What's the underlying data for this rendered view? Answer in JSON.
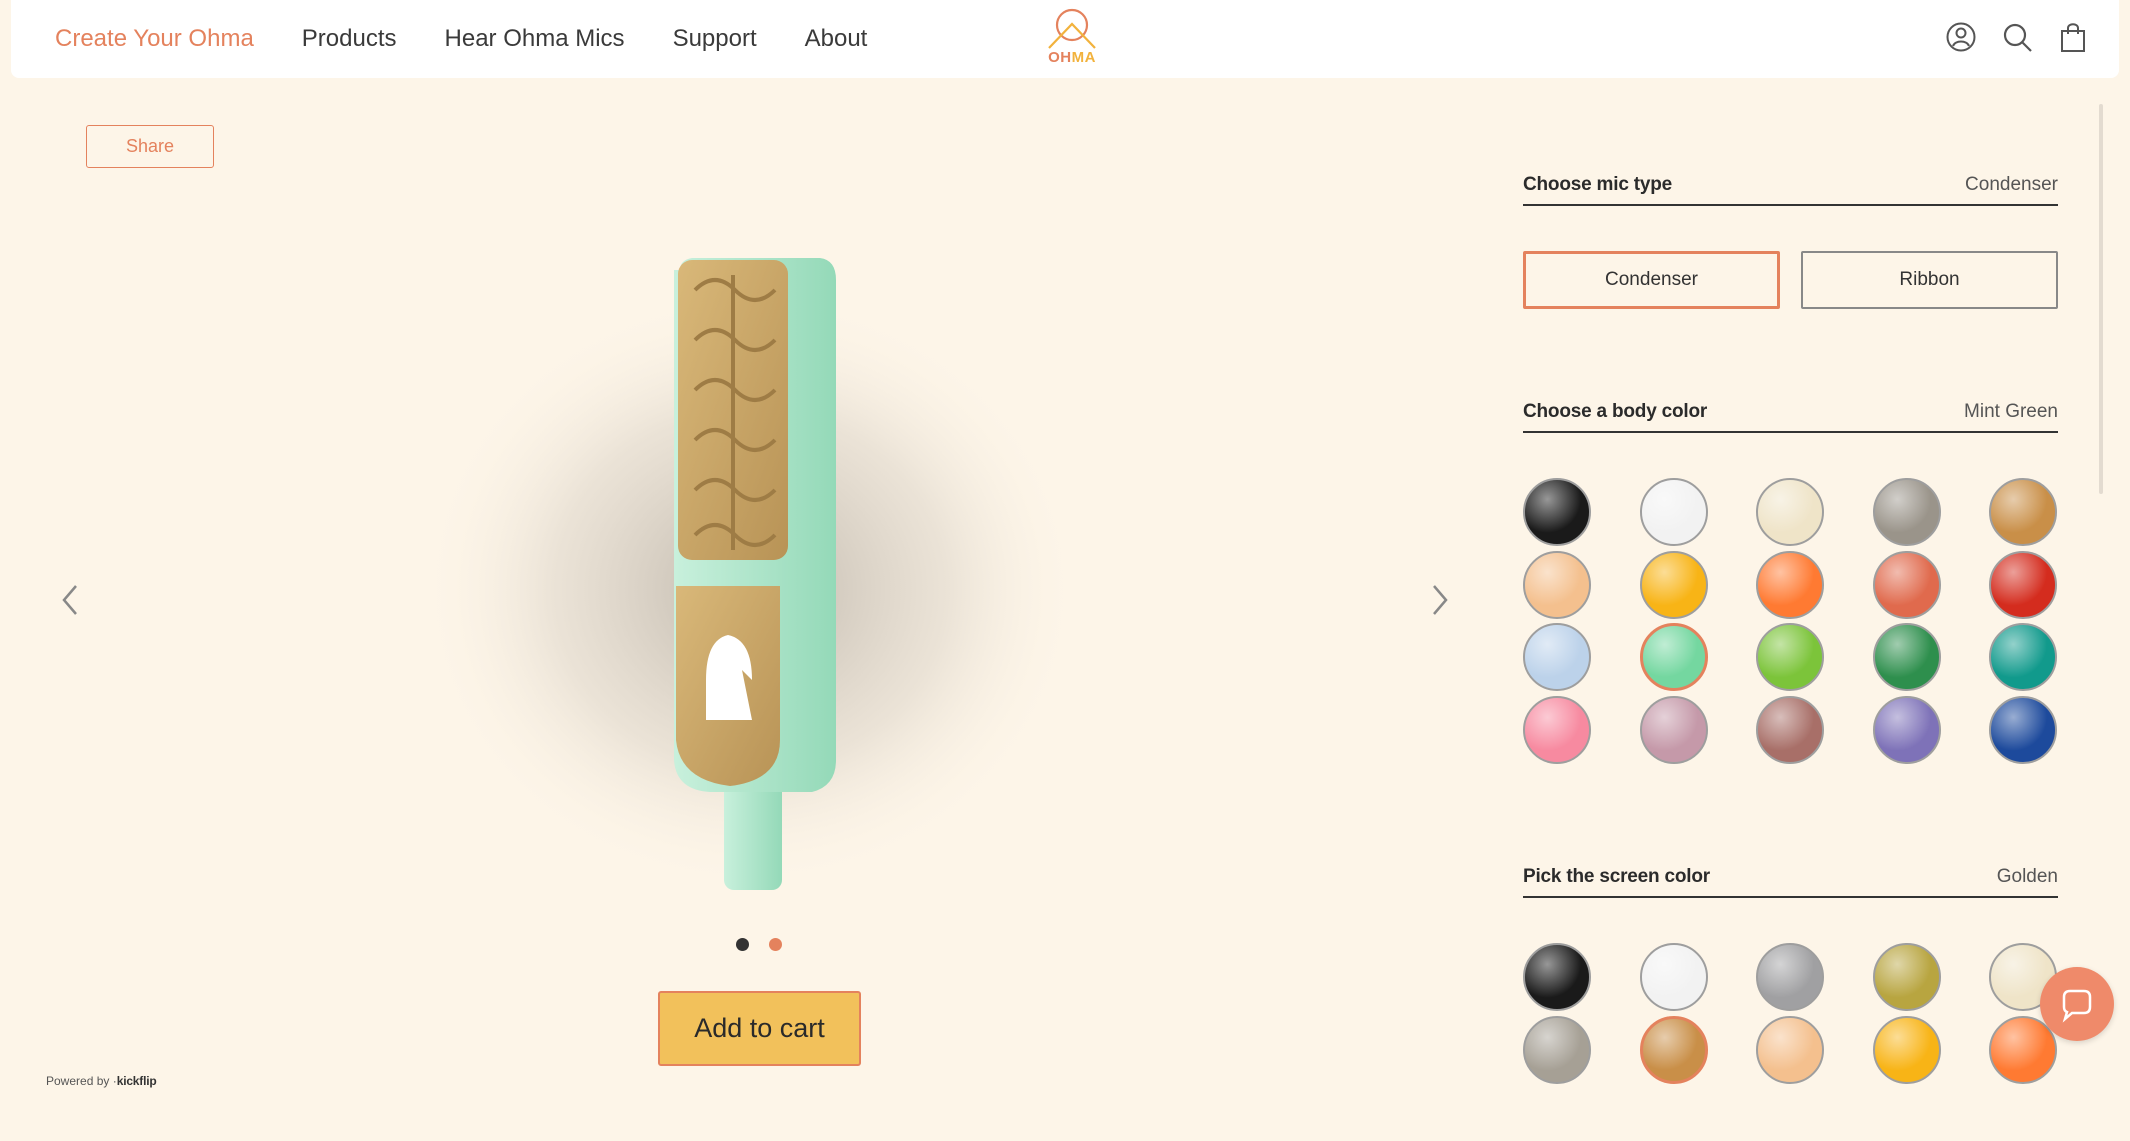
{
  "nav": {
    "items": [
      "Create Your Ohma",
      "Products",
      "Hear Ohma Mics",
      "Support",
      "About"
    ],
    "active_index": 0
  },
  "logo": {
    "text_oh": "OH",
    "text_ma": "MA"
  },
  "header_icons": [
    "account-icon",
    "search-icon",
    "cart-bag-icon"
  ],
  "viewer": {
    "share_label": "Share",
    "add_to_cart_label": "Add to cart",
    "powered_by": "Powered by",
    "powered_brand": "kickflip",
    "slide_count": 2,
    "active_slide": 1
  },
  "mic_type": {
    "title": "Choose mic type",
    "value": "Condenser",
    "options": [
      "Condenser",
      "Ribbon"
    ],
    "selected_index": 0
  },
  "body_color": {
    "title": "Choose a body color",
    "value": "Mint Green",
    "selected_index": 11,
    "swatches": [
      "#1a1a1a",
      "#f2f2f2",
      "#efe4c8",
      "#9a948a",
      "#c98f48",
      "#f4c08e",
      "#f8b416",
      "#ff7a32",
      "#e06a4d",
      "#d42c1e",
      "#bcd2ea",
      "#74d7a0",
      "#7cc43a",
      "#2e8f4d",
      "#119a8c",
      "#f78aa0",
      "#c599a9",
      "#a86f68",
      "#7e72b8",
      "#1d4a9c"
    ]
  },
  "screen_color": {
    "title": "Pick the screen color",
    "value": "Golden",
    "selected_index": 6,
    "swatches": [
      "#1a1a1a",
      "#f2f2f2",
      "#a0a0a2",
      "#b8a540",
      "#efe4c8",
      "#a6a095",
      "#c98f48",
      "#f4c08e",
      "#f8b416",
      "#ff7a32"
    ]
  },
  "colors": {
    "accent": "#e4825d",
    "background": "#fdf5e8",
    "cart_button": "#f2c15b"
  }
}
